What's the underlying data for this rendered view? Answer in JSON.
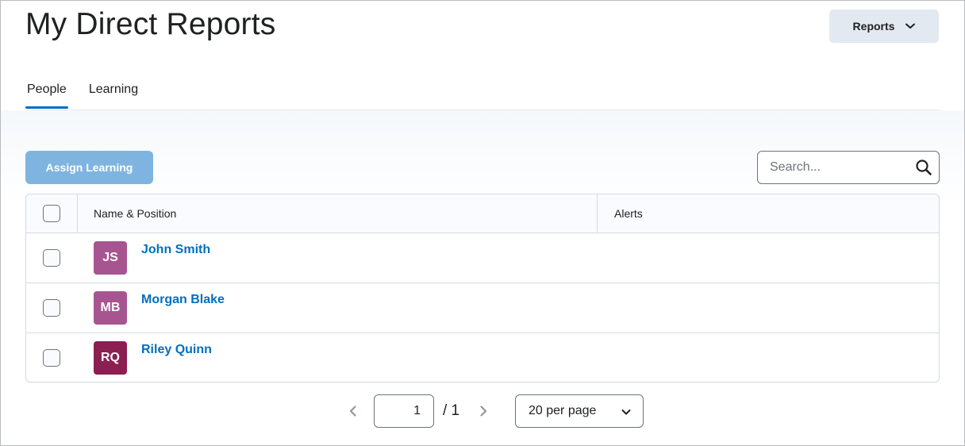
{
  "page": {
    "title": "My Direct Reports"
  },
  "header": {
    "reports_label": "Reports"
  },
  "tabs": [
    {
      "label": "People",
      "active": true
    },
    {
      "label": "Learning",
      "active": false
    }
  ],
  "toolbar": {
    "assign_label": "Assign Learning",
    "search_placeholder": "Search...",
    "search_value": ""
  },
  "table": {
    "columns": [
      "Name & Position",
      "Alerts"
    ],
    "rows": [
      {
        "initials": "JS",
        "name": "John Smith",
        "avatar_color": "#a75590",
        "alerts": ""
      },
      {
        "initials": "MB",
        "name": "Morgan Blake",
        "avatar_color": "#a75590",
        "alerts": ""
      },
      {
        "initials": "RQ",
        "name": "Riley Quinn",
        "avatar_color": "#8b1f52",
        "alerts": ""
      }
    ]
  },
  "pager": {
    "current_page": "1",
    "total_label": "/ 1",
    "page_size_label": "20 per page"
  },
  "colors": {
    "accent": "#006fbf",
    "assign_button": "#7fb4e1",
    "reports_button": "#e3e9f1"
  },
  "icons": {
    "reports_chevron": "chevron-down-icon",
    "search": "search-icon",
    "prev": "chevron-left-icon",
    "next": "chevron-right-icon",
    "page_size_chevron": "chevron-down-icon"
  }
}
